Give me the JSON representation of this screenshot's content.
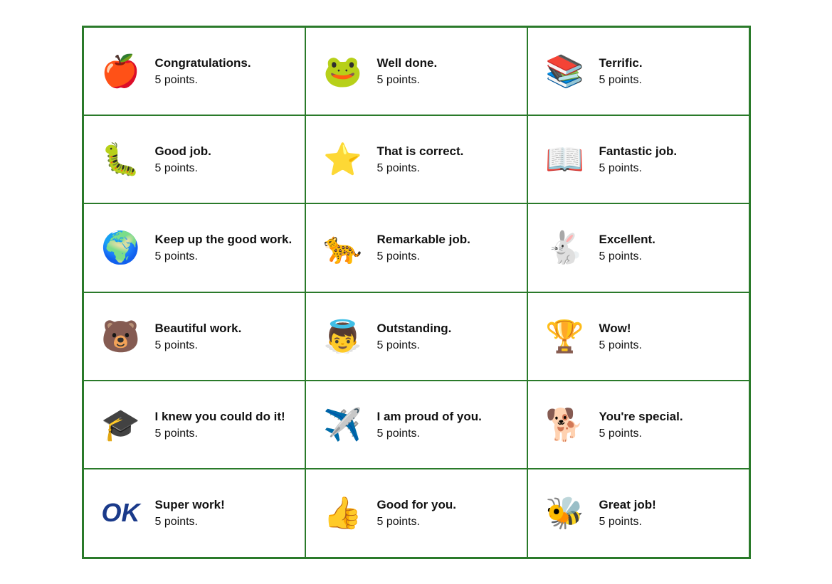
{
  "cards": [
    {
      "id": "congratulations",
      "title": "Congratulations.",
      "points": "5 points.",
      "icon": "🍎",
      "icon_label": "apple-worm-icon"
    },
    {
      "id": "well-done",
      "title": "Well done.",
      "points": "5 points.",
      "icon": "🐸",
      "icon_label": "frog-icon"
    },
    {
      "id": "terrific",
      "title": "Terrific.",
      "points": "5 points.",
      "icon": "📚",
      "icon_label": "books-icon"
    },
    {
      "id": "good-job",
      "title": "Good job.",
      "points": "5 points.",
      "icon": "🐛",
      "icon_label": "caterpillar-icon"
    },
    {
      "id": "that-is-correct",
      "title": "That is correct.",
      "points": "5 points.",
      "icon": "⭐",
      "icon_label": "star-icon"
    },
    {
      "id": "fantastic-job",
      "title": "Fantastic job.",
      "points": "5 points.",
      "icon": "📖",
      "icon_label": "book-face-icon"
    },
    {
      "id": "keep-up",
      "title": "Keep up the good work.",
      "points": "5 points.",
      "icon": "🌍",
      "icon_label": "globe-kid-icon"
    },
    {
      "id": "remarkable-job",
      "title": "Remarkable job.",
      "points": "5 points.",
      "icon": "🐆",
      "icon_label": "cat-icon"
    },
    {
      "id": "excellent",
      "title": "Excellent.",
      "points": "5 points.",
      "icon": "🐇",
      "icon_label": "rabbit-icon"
    },
    {
      "id": "beautiful-work",
      "title": "Beautiful work.",
      "points": "5 points.",
      "icon": "🐻",
      "icon_label": "bear-icon"
    },
    {
      "id": "outstanding",
      "title": "Outstanding.",
      "points": "5 points.",
      "icon": "👼",
      "icon_label": "angel-icon"
    },
    {
      "id": "wow",
      "title": "Wow!",
      "points": "5 points.",
      "icon": "🏆",
      "icon_label": "trophy-dog-icon"
    },
    {
      "id": "knew-you",
      "title": "I knew you could do it!",
      "points": "5 points.",
      "icon": "🎓",
      "icon_label": "graduate-icon"
    },
    {
      "id": "proud-of-you",
      "title": "I am proud of you.",
      "points": "5 points.",
      "icon": "✈️",
      "icon_label": "plane-icon"
    },
    {
      "id": "youre-special",
      "title": "You're special.",
      "points": "5 points.",
      "icon": "🐕",
      "icon_label": "dog-book-icon"
    },
    {
      "id": "super-work",
      "title": "Super work!",
      "points": "5 points.",
      "icon": "OK",
      "icon_label": "ok-icon"
    },
    {
      "id": "good-for-you",
      "title": "Good for you.",
      "points": "5 points.",
      "icon": "👍",
      "icon_label": "thumbs-up-icon"
    },
    {
      "id": "great-job",
      "title": "Great job!",
      "points": "5 points.",
      "icon": "🐝",
      "icon_label": "bee-icon"
    }
  ]
}
